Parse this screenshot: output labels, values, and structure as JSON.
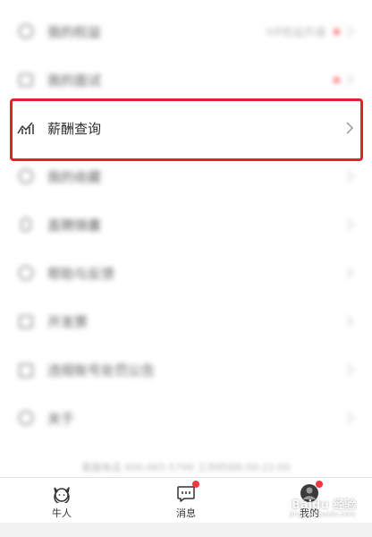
{
  "menu": {
    "items": [
      {
        "icon": "circle-icon",
        "label": "我的权益",
        "right_text": "VIP权益开通",
        "has_dot": true,
        "blurred": true
      },
      {
        "icon": "bag-icon",
        "label": "我的面试",
        "right_text": "",
        "has_dot": true,
        "blurred": true
      },
      {
        "icon": "chart-line-icon",
        "label": "薪酬查询",
        "right_text": "",
        "has_dot": false,
        "blurred": false
      },
      {
        "icon": "chat-icon",
        "label": "我的收藏",
        "right_text": "",
        "has_dot": false,
        "blurred": true
      },
      {
        "icon": "hand-icon",
        "label": "直聘锦囊",
        "right_text": "",
        "has_dot": false,
        "blurred": true
      },
      {
        "icon": "help-icon",
        "label": "帮助与反馈",
        "right_text": "",
        "has_dot": false,
        "blurred": true
      },
      {
        "icon": "calendar-icon",
        "label": "开发票",
        "right_text": "",
        "has_dot": false,
        "blurred": true
      },
      {
        "icon": "clipboard-icon",
        "label": "违规账号处罚公告",
        "right_text": "",
        "has_dot": false,
        "blurred": true
      },
      {
        "icon": "info-icon",
        "label": "关于",
        "right_text": "",
        "has_dot": false,
        "blurred": true
      }
    ]
  },
  "footer_note": "客服电话 400-065-5799 工作时间8:00-22:00",
  "tabs": [
    {
      "label": "牛人",
      "icon": "cat-face-icon",
      "badge": false
    },
    {
      "label": "消息",
      "icon": "message-icon",
      "badge": true
    },
    {
      "label": "我的",
      "icon": "avatar-icon",
      "badge": true
    }
  ],
  "watermark": {
    "text": "Baidu 经验",
    "sub": "jingyan.baidu.com"
  },
  "colors": {
    "highlight_border": "#e5202a",
    "badge": "#f2373c",
    "text": "#2b2b2b"
  }
}
